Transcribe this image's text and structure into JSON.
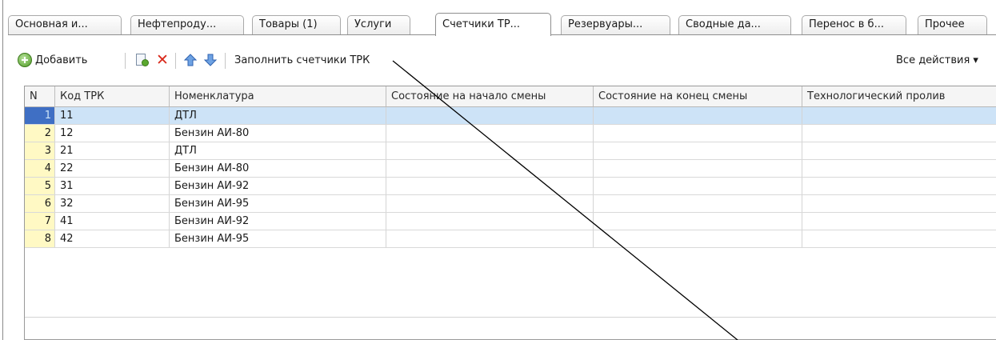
{
  "tabs": [
    {
      "label": "Основная и...",
      "active": false
    },
    {
      "label": "Нефтепроду...",
      "active": false
    },
    {
      "label": "Товары (1)",
      "active": false
    },
    {
      "label": "Услуги",
      "active": false
    },
    {
      "label": "Счетчики ТР...",
      "active": true
    },
    {
      "label": "Резервуары...",
      "active": false
    },
    {
      "label": "Сводные да...",
      "active": false
    },
    {
      "label": "Перенос в б...",
      "active": false
    },
    {
      "label": "Прочее",
      "active": false
    }
  ],
  "toolbar": {
    "add_label": "Добавить",
    "fill_label": "Заполнить счетчики ТРК",
    "all_actions_label": "Все действия ▾"
  },
  "table": {
    "columns": [
      "N",
      "Код ТРК",
      "Номенклатура",
      "Состояние на начало смены",
      "Состояние на конец смены",
      "Технологический пролив"
    ],
    "rows": [
      {
        "n": "1",
        "code": "11",
        "item": "ДТЛ",
        "start": "",
        "end": "",
        "tech": "",
        "selected": true
      },
      {
        "n": "2",
        "code": "12",
        "item": "Бензин АИ-80",
        "start": "",
        "end": "",
        "tech": "",
        "selected": false
      },
      {
        "n": "3",
        "code": "21",
        "item": "ДТЛ",
        "start": "",
        "end": "",
        "tech": "",
        "selected": false
      },
      {
        "n": "4",
        "code": "22",
        "item": "Бензин АИ-80",
        "start": "",
        "end": "",
        "tech": "",
        "selected": false
      },
      {
        "n": "5",
        "code": "31",
        "item": "Бензин АИ-92",
        "start": "",
        "end": "",
        "tech": "",
        "selected": false
      },
      {
        "n": "6",
        "code": "32",
        "item": "Бензин АИ-95",
        "start": "",
        "end": "",
        "tech": "",
        "selected": false
      },
      {
        "n": "7",
        "code": "41",
        "item": "Бензин АИ-92",
        "start": "",
        "end": "",
        "tech": "",
        "selected": false
      },
      {
        "n": "8",
        "code": "42",
        "item": "Бензин АИ-95",
        "start": "",
        "end": "",
        "tech": "",
        "selected": false
      }
    ]
  },
  "icons": {
    "add": "add-circle-icon",
    "copy": "copy-document-icon",
    "delete": "delete-x-icon",
    "move_up": "arrow-up-icon",
    "move_down": "arrow-down-icon"
  },
  "colors": {
    "selected_row": "#cde3f7",
    "line_number_bg": "#fff9c4",
    "selected_number_bg": "#3f6fc4",
    "delete_icon": "#d92a1c",
    "arrow_icon": "#3b7ad0"
  }
}
